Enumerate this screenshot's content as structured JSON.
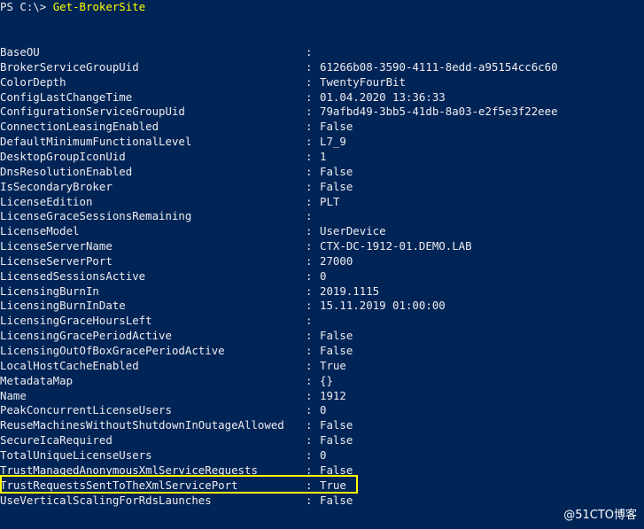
{
  "prompt": {
    "path": "PS C:\\> ",
    "command": "Get-BrokerSite"
  },
  "properties": [
    {
      "name": "BaseOU",
      "value": ""
    },
    {
      "name": "BrokerServiceGroupUid",
      "value": "61266b08-3590-4111-8edd-a95154cc6c60"
    },
    {
      "name": "ColorDepth",
      "value": "TwentyFourBit"
    },
    {
      "name": "ConfigLastChangeTime",
      "value": "01.04.2020 13:36:33"
    },
    {
      "name": "ConfigurationServiceGroupUid",
      "value": "79afbd49-3bb5-41db-8a03-e2f5e3f22eee"
    },
    {
      "name": "ConnectionLeasingEnabled",
      "value": "False"
    },
    {
      "name": "DefaultMinimumFunctionalLevel",
      "value": "L7_9"
    },
    {
      "name": "DesktopGroupIconUid",
      "value": "1"
    },
    {
      "name": "DnsResolutionEnabled",
      "value": "False"
    },
    {
      "name": "IsSecondaryBroker",
      "value": "False"
    },
    {
      "name": "LicenseEdition",
      "value": "PLT"
    },
    {
      "name": "LicenseGraceSessionsRemaining",
      "value": ""
    },
    {
      "name": "LicenseModel",
      "value": "UserDevice"
    },
    {
      "name": "LicenseServerName",
      "value": "CTX-DC-1912-01.DEMO.LAB"
    },
    {
      "name": "LicenseServerPort",
      "value": "27000"
    },
    {
      "name": "LicensedSessionsActive",
      "value": "0"
    },
    {
      "name": "LicensingBurnIn",
      "value": "2019.1115"
    },
    {
      "name": "LicensingBurnInDate",
      "value": "15.11.2019 01:00:00"
    },
    {
      "name": "LicensingGraceHoursLeft",
      "value": ""
    },
    {
      "name": "LicensingGracePeriodActive",
      "value": "False"
    },
    {
      "name": "LicensingOutOfBoxGracePeriodActive",
      "value": "False"
    },
    {
      "name": "LocalHostCacheEnabled",
      "value": "True"
    },
    {
      "name": "MetadataMap",
      "value": "{}"
    },
    {
      "name": "Name",
      "value": "1912"
    },
    {
      "name": "PeakConcurrentLicenseUsers",
      "value": "0"
    },
    {
      "name": "ReuseMachinesWithoutShutdownInOutageAllowed",
      "value": "False"
    },
    {
      "name": "SecureIcaRequired",
      "value": "False"
    },
    {
      "name": "TotalUniqueLicenseUsers",
      "value": "0"
    },
    {
      "name": "TrustManagedAnonymousXmlServiceRequests",
      "value": "False"
    },
    {
      "name": "TrustRequestsSentToTheXmlServicePort",
      "value": "True"
    },
    {
      "name": "UseVerticalScalingForRdsLaunches",
      "value": "False"
    }
  ],
  "separator": ":",
  "watermark": "@51CTO博客",
  "colors": {
    "background": "#012456",
    "text": "#eeedf0",
    "command": "#ffff00",
    "highlight_border": "#ffff00"
  }
}
